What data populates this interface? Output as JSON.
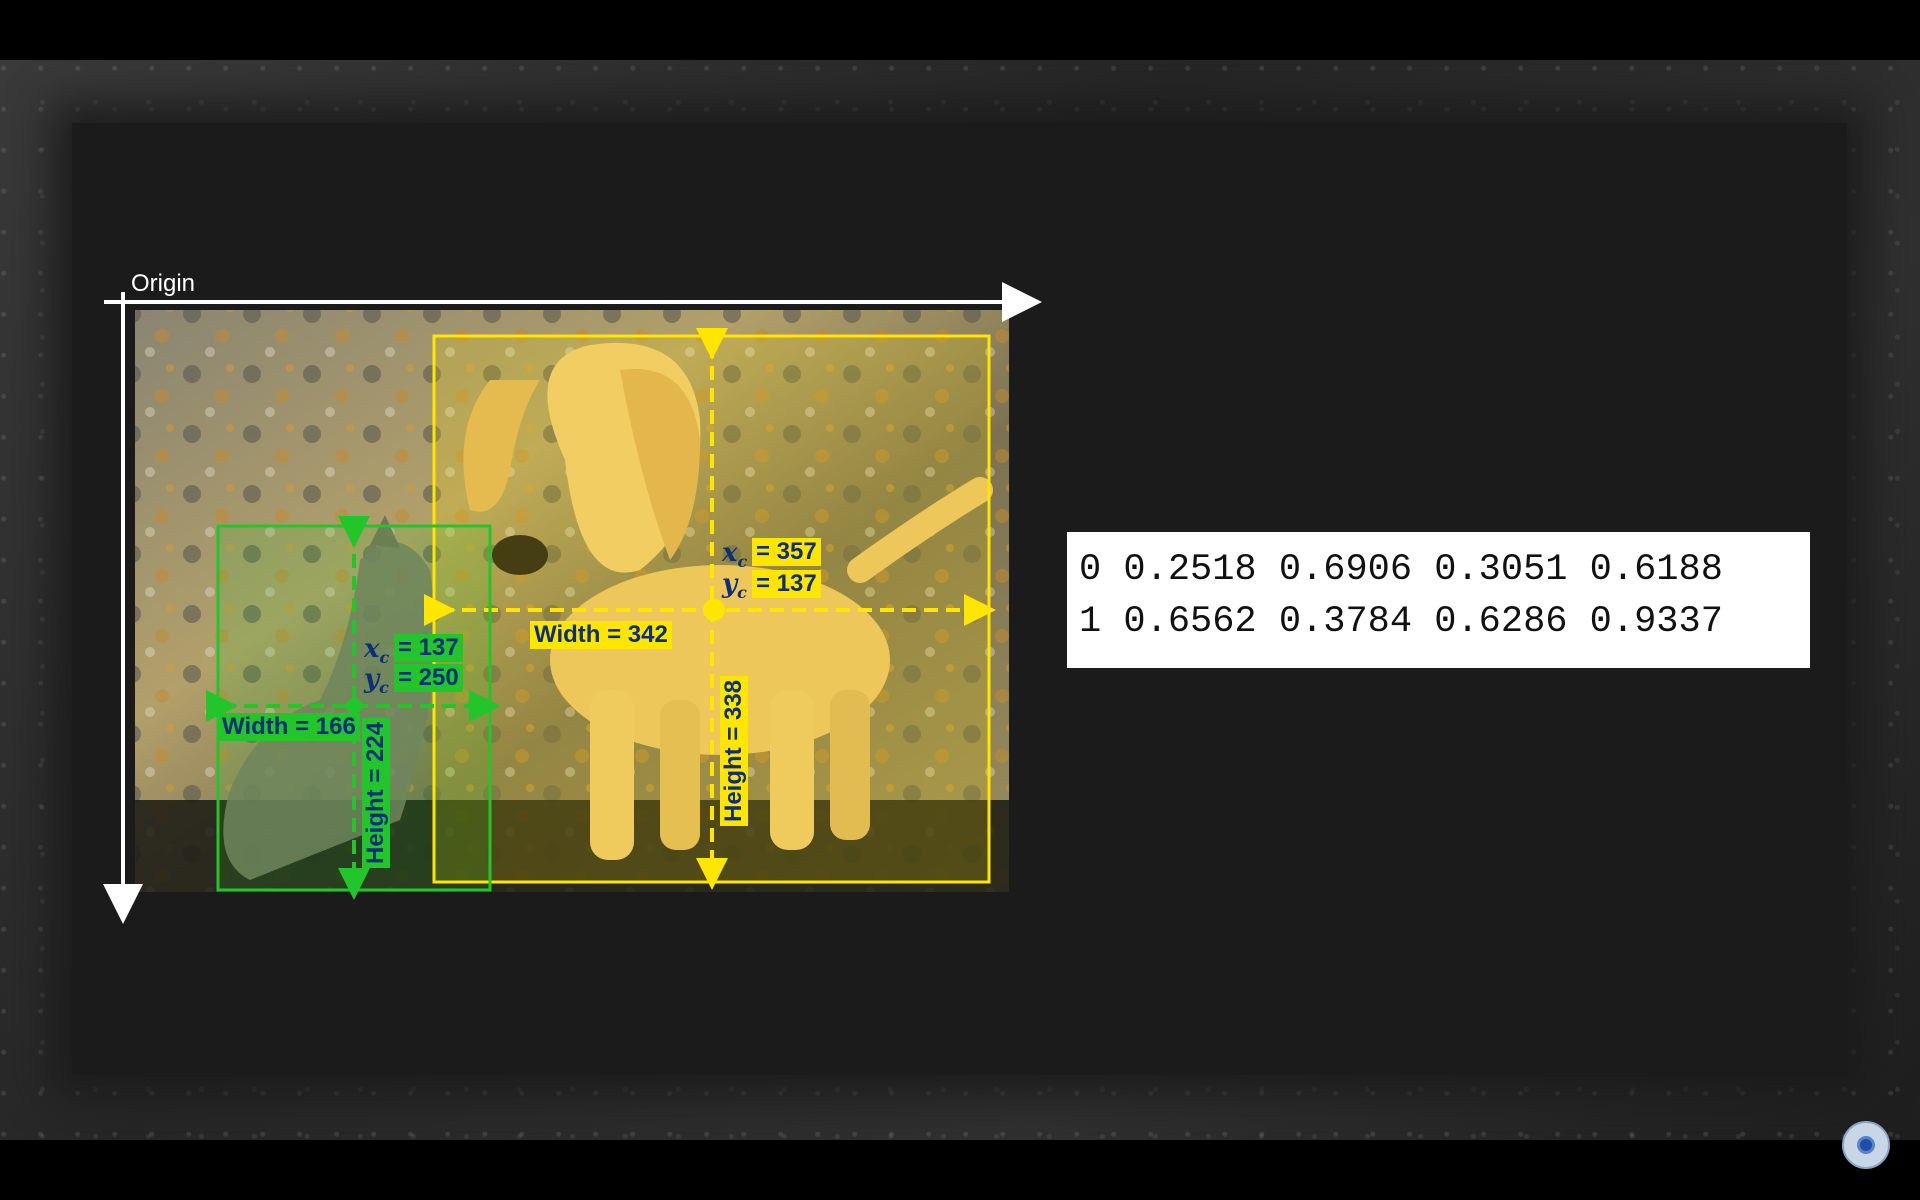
{
  "origin_label": "Origin",
  "dog_box": {
    "xc_value": "= 357",
    "yc_value": "= 137",
    "width_label": "Width = 342",
    "height_label": "Height = 338",
    "color": "#ffe600"
  },
  "cat_box": {
    "xc_value": "= 137",
    "yc_value": "= 250",
    "width_label": "Width = 166",
    "height_label": "Height = 224",
    "color": "#22c62a"
  },
  "math_symbols": {
    "xc": "x",
    "yc": "y",
    "sub": "c"
  },
  "annotation_lines": [
    "0 0.2518 0.6906 0.3051 0.6188",
    "1 0.6562 0.3784 0.6286 0.9337"
  ],
  "icons": {
    "record": "record-button-icon"
  }
}
